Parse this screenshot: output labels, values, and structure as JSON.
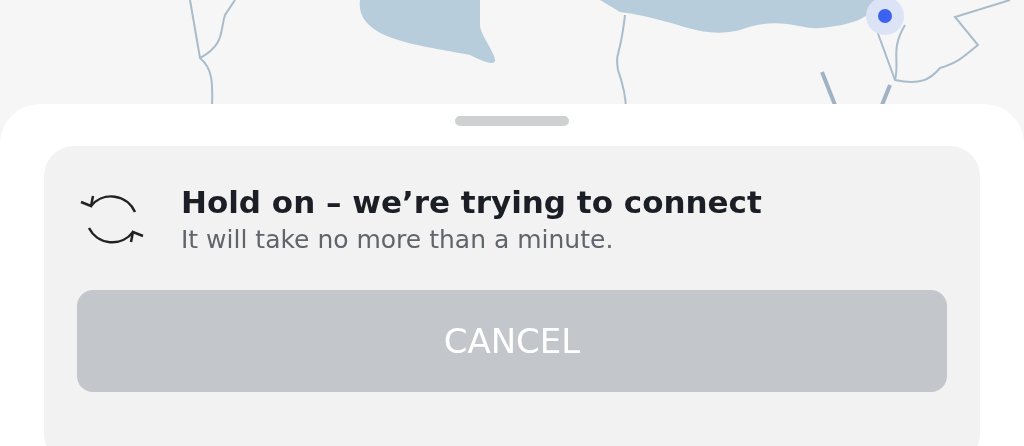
{
  "connection_notice": {
    "title": "Hold on – we’re trying to connect",
    "message": "It will take no more than a minute."
  },
  "cancel_button": {
    "label": "CANCEL",
    "disabled": true
  }
}
